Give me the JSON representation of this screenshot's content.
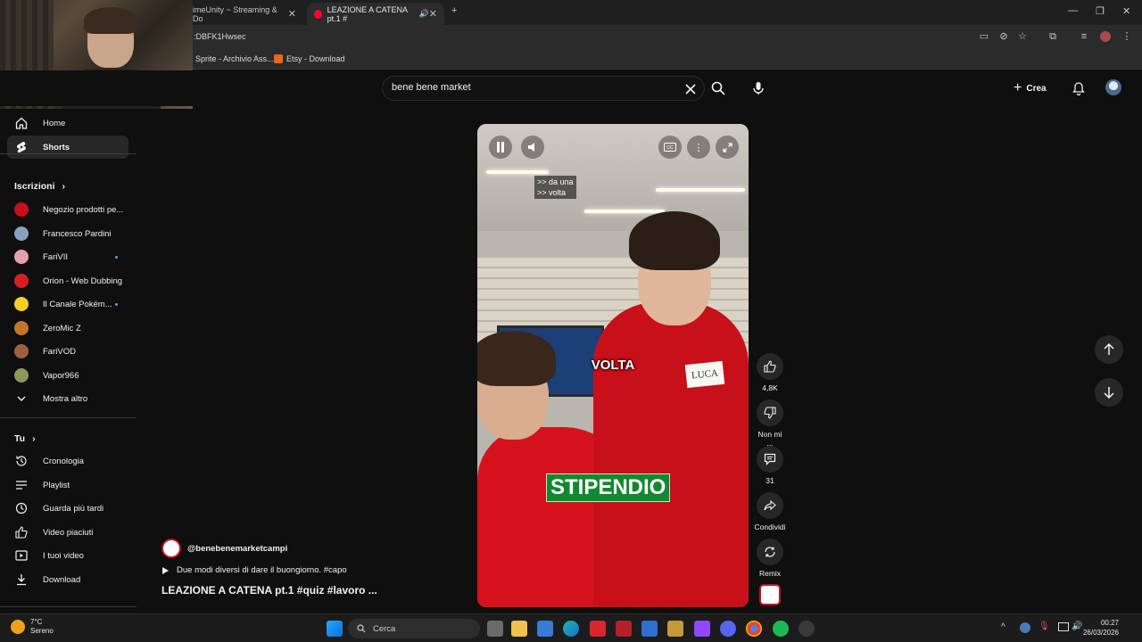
{
  "browser": {
    "tabs": [
      {
        "label": "imeUnity ~ Streaming & Do",
        "active": false
      },
      {
        "label": "LEAZIONE A CATENA pt.1 #",
        "active": true
      }
    ],
    "url": ":DBFK1Hwsec",
    "bookmarks": [
      {
        "label": "Sprite - Archivio Ass..."
      },
      {
        "label": "Etsy - Download"
      }
    ]
  },
  "youtube": {
    "search_value": "bene bene market",
    "create_label": "Crea"
  },
  "sidebar": {
    "main": [
      {
        "label": "Home",
        "icon": "home-icon"
      },
      {
        "label": "Shorts",
        "icon": "shorts-icon",
        "active": true
      }
    ],
    "subscriptions_header": "Iscrizioni",
    "subscriptions": [
      {
        "label": "Negozio prodotti pe...",
        "color": "#c8101a",
        "dot": false
      },
      {
        "label": "Francesco Pardini",
        "color": "#8aa0c0",
        "dot": false
      },
      {
        "label": "FariVII",
        "color": "#e4a0b0",
        "dot": true
      },
      {
        "label": "Orion - Web Dubbing",
        "color": "#d62020",
        "dot": false
      },
      {
        "label": "Il Canale Pokém...",
        "color": "#f5d020",
        "dot": true
      },
      {
        "label": "ZeroMic Z",
        "color": "#c0782a",
        "dot": false
      },
      {
        "label": "FariVOD",
        "color": "#a06040",
        "dot": false
      },
      {
        "label": "Vapor966",
        "color": "#8a9a5a",
        "dot": false
      }
    ],
    "show_more": "Mostra altro",
    "you_header": "Tu",
    "you": [
      {
        "label": "Cronologia",
        "icon": "history-icon"
      },
      {
        "label": "Playlist",
        "icon": "playlist-icon"
      },
      {
        "label": "Guarda più tardi",
        "icon": "watch-later-icon"
      },
      {
        "label": "Video piaciuti",
        "icon": "liked-icon"
      },
      {
        "label": "I tuoi video",
        "icon": "your-videos-icon"
      },
      {
        "label": "Download",
        "icon": "download-icon"
      }
    ]
  },
  "video": {
    "subtitle_small": ">> da una\n>> volta",
    "caption_1": "VOLTA",
    "caption_2": "STIPENDIO",
    "badge": "LUCA"
  },
  "actions": {
    "likes": "4,8K",
    "dislike": "Non mi ...",
    "comments": "31",
    "share": "Condividi",
    "remix": "Remix"
  },
  "meta": {
    "channel": "@benebenemarketcampi",
    "description": "Due modi diversi di dare il buongiorno. #capo",
    "title": "LEAZIONE A CATENA pt.1 #quiz #lavoro ..."
  },
  "taskbar": {
    "weather_temp": "7°C",
    "weather_desc": "Sereno",
    "search_label": "Cerca",
    "time": "00:27",
    "date": "26/03/2026"
  }
}
